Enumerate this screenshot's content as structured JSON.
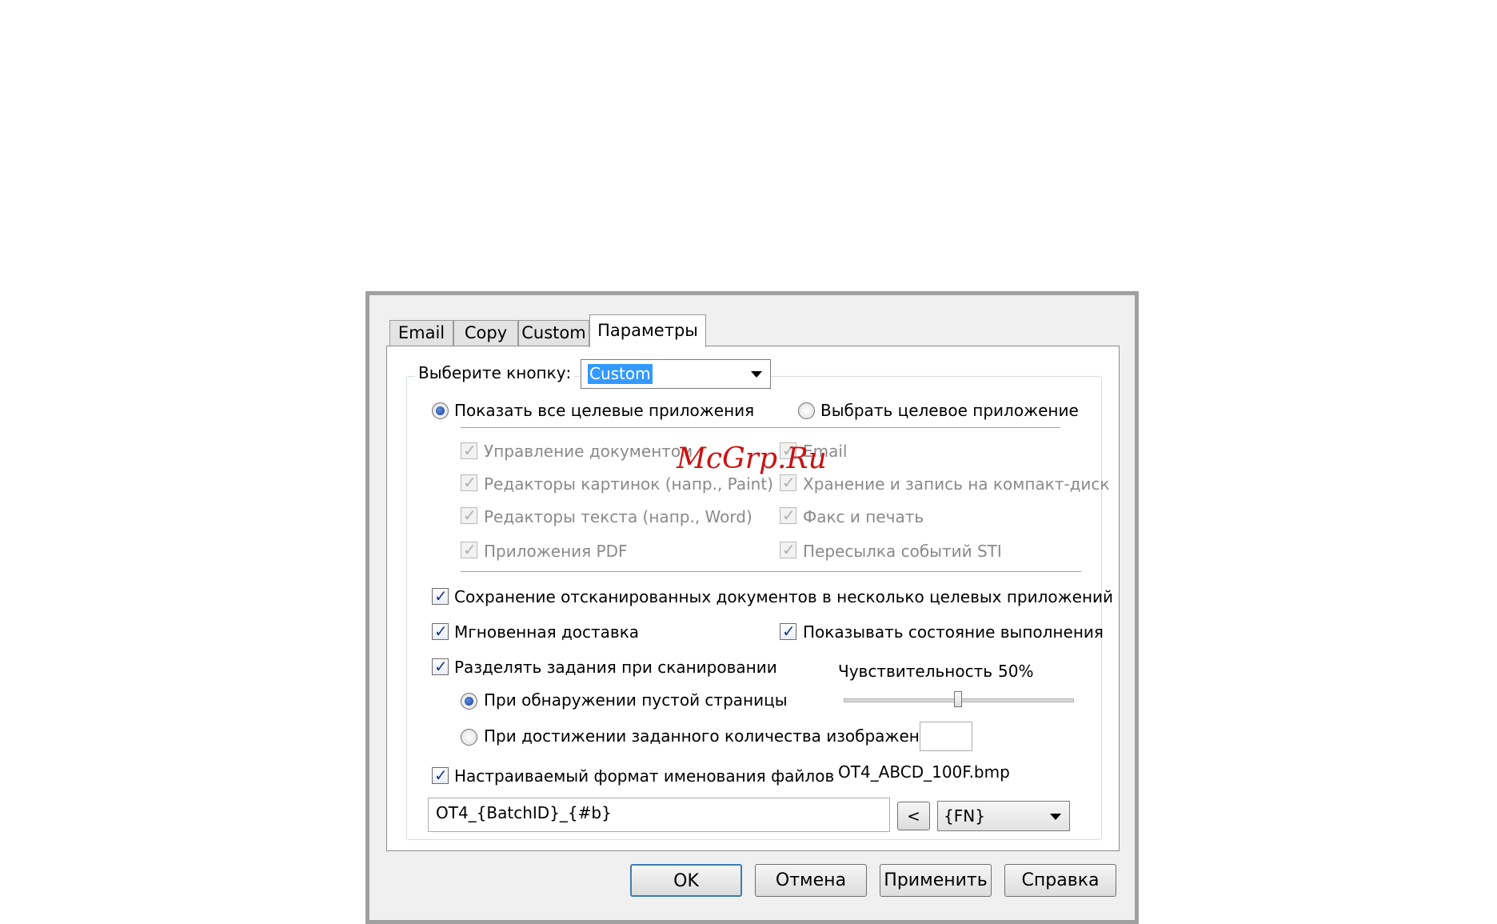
{
  "tabs": [
    "Email",
    "Copy",
    "Custom",
    "Параметры"
  ],
  "active_tab": "Параметры",
  "select_button": {
    "label": "Выберите кнопку:",
    "value": "Custom"
  },
  "radio_show_all": {
    "label": "Показать все целевые приложения",
    "checked": true
  },
  "radio_select_target": {
    "label": "Выбрать целевое приложение",
    "checked": false
  },
  "app_types_left": [
    "Управление документом",
    "Редакторы картинок (напр., Paint)",
    "Редакторы текста (напр., Word)",
    "Приложения PDF"
  ],
  "app_types_right": [
    "Email",
    "Хранение и запись на компакт-диск",
    "Факс и печать",
    "Пересылка событий STI"
  ],
  "options": {
    "save_multiple": "Сохранение отсканированных документов в несколько целевых приложений",
    "instant_delivery": "Мгновенная доставка",
    "show_progress": "Показывать состояние выполнения",
    "split_jobs": "Разделять задания при сканировании",
    "blank_page": "При обнаружении пустой страницы",
    "image_count": "При достижении заданного количества изображений",
    "custom_naming": "Настраиваемый формат именования файлов"
  },
  "sensitivity": {
    "label": "Чувствительность",
    "value": "50%",
    "level_percent": 50
  },
  "image_count_value": "",
  "filename_preview": "OT4_ABCD_100F.bmp",
  "filename_format": "OT4_{BatchID}_{#b}",
  "insert_button": "<",
  "token_select": "{FN}",
  "buttons": {
    "ok": "OK",
    "cancel": "Отмена",
    "apply": "Применить",
    "help": "Справка"
  },
  "watermark": "McGrp.Ru",
  "colors": {
    "selection": "#3399ff",
    "disabled_text": "#8a8a8a",
    "default_button_border": "#3c7fb1"
  }
}
